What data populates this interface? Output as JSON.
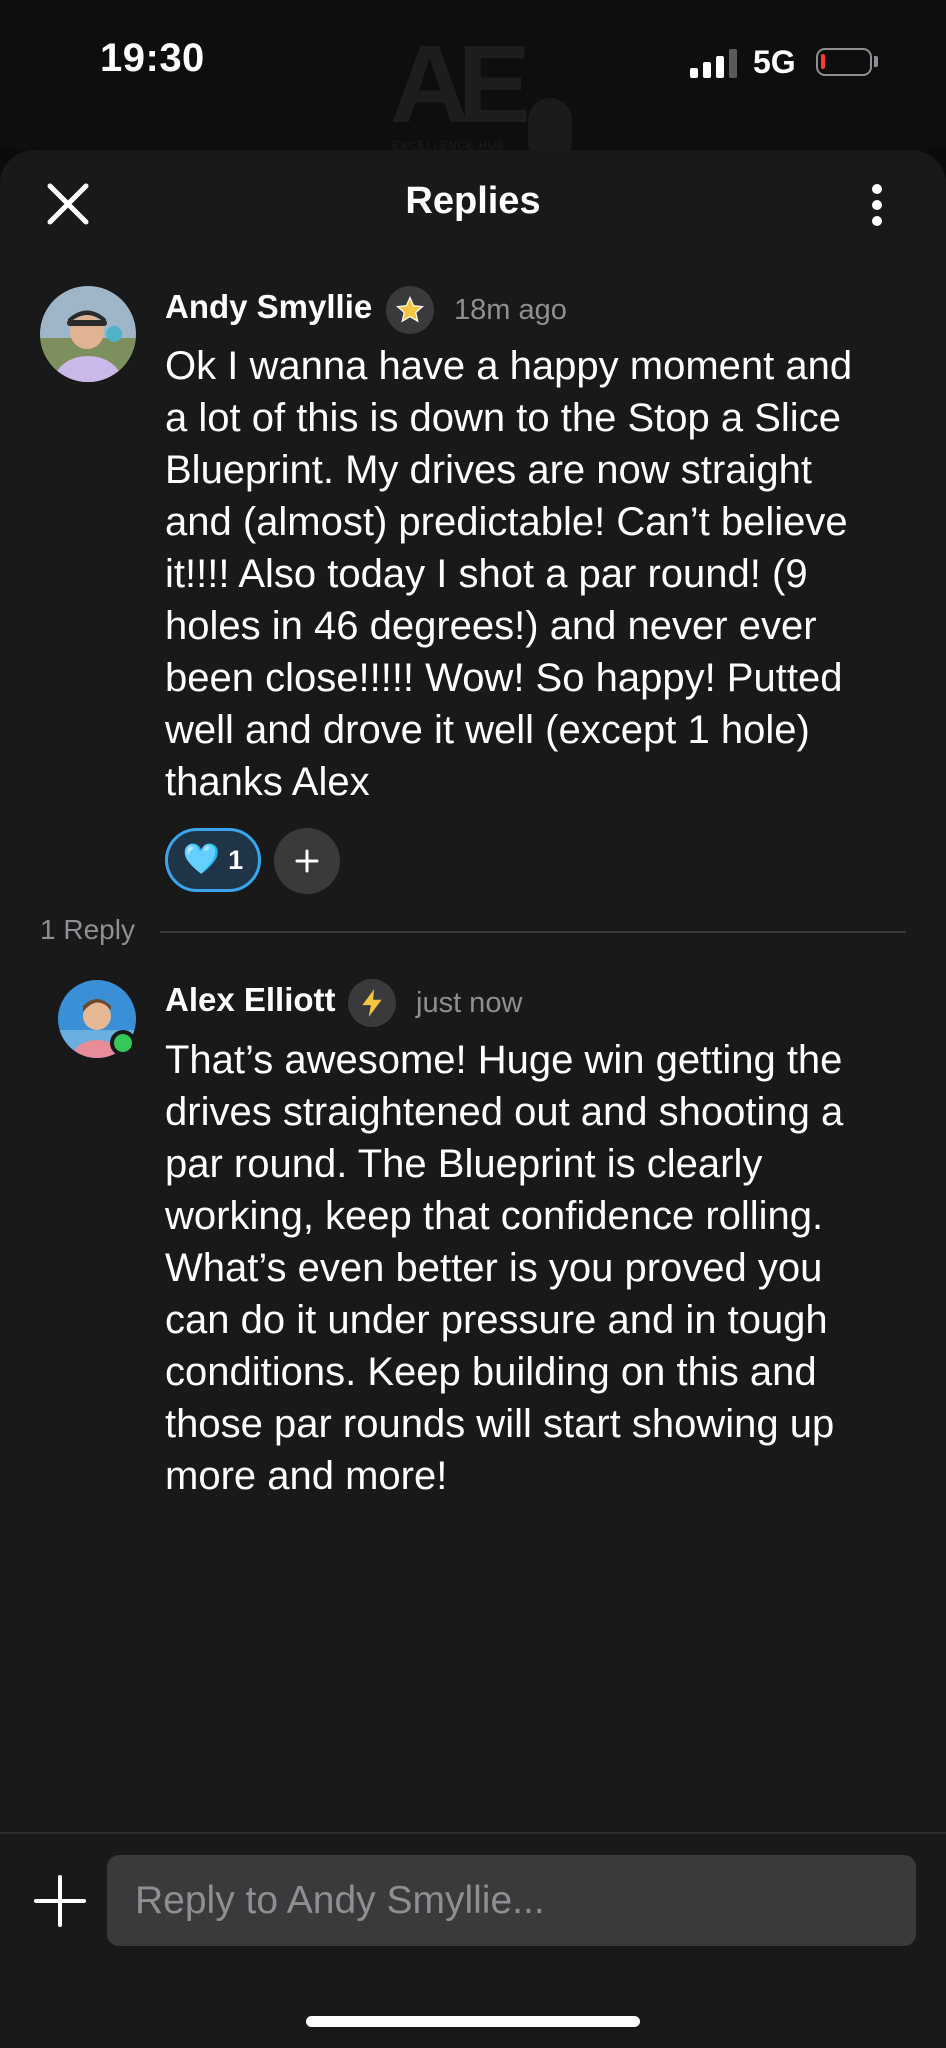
{
  "status_bar": {
    "time": "19:30",
    "network": "5G",
    "battery_level": 0.08,
    "signal_bars_active": 3,
    "signal_bars_total": 4
  },
  "background_app": {
    "logo_text": "AE",
    "logo_subtext": "EXCELLENCE HUB"
  },
  "sheet": {
    "title": "Replies",
    "close_icon": "close-icon",
    "more_icon": "more-vertical-icon"
  },
  "original_post": {
    "author": "Andy Smyllie",
    "badge_icon": "star-icon",
    "timestamp": "18m ago",
    "body": "Ok I wanna have a happy moment and\na lot of this is down to the Stop a Slice\nBlueprint. My drives are now straight\nand (almost) predictable! Can’t believe\nit!!!! Also today I shot a par round! (9\nholes in 46 degrees!) and never ever\nbeen close!!!!! Wow! So happy! Putted\nwell and drove it well (except 1 hole)\nthanks Alex",
    "reaction": {
      "emoji": "🩵",
      "count": "1"
    },
    "add_reaction_icon": "plus-icon"
  },
  "thread": {
    "reply_count_label": "1 Reply"
  },
  "reply": {
    "author": "Alex Elliott",
    "badge_icon": "lightning-icon",
    "timestamp": "just now",
    "online": true,
    "body": "That’s awesome! Huge win getting the\ndrives straightened out and shooting a\npar round. The Blueprint is clearly\nworking, keep that confidence rolling.\nWhat’s even better is you proved you\ncan do it under pressure and in tough\nconditions. Keep building on this and\nthose par rounds will start showing up\nmore and more!"
  },
  "composer": {
    "attach_icon": "plus-icon",
    "value": "",
    "placeholder": "Reply to Andy Smyllie..."
  },
  "colors": {
    "sheet_background": "#19191a",
    "accent_blue": "#3aa5ee",
    "online_green": "#34c759",
    "battery_red": "#ff3b30",
    "secondary_text": "#8e8e93"
  }
}
